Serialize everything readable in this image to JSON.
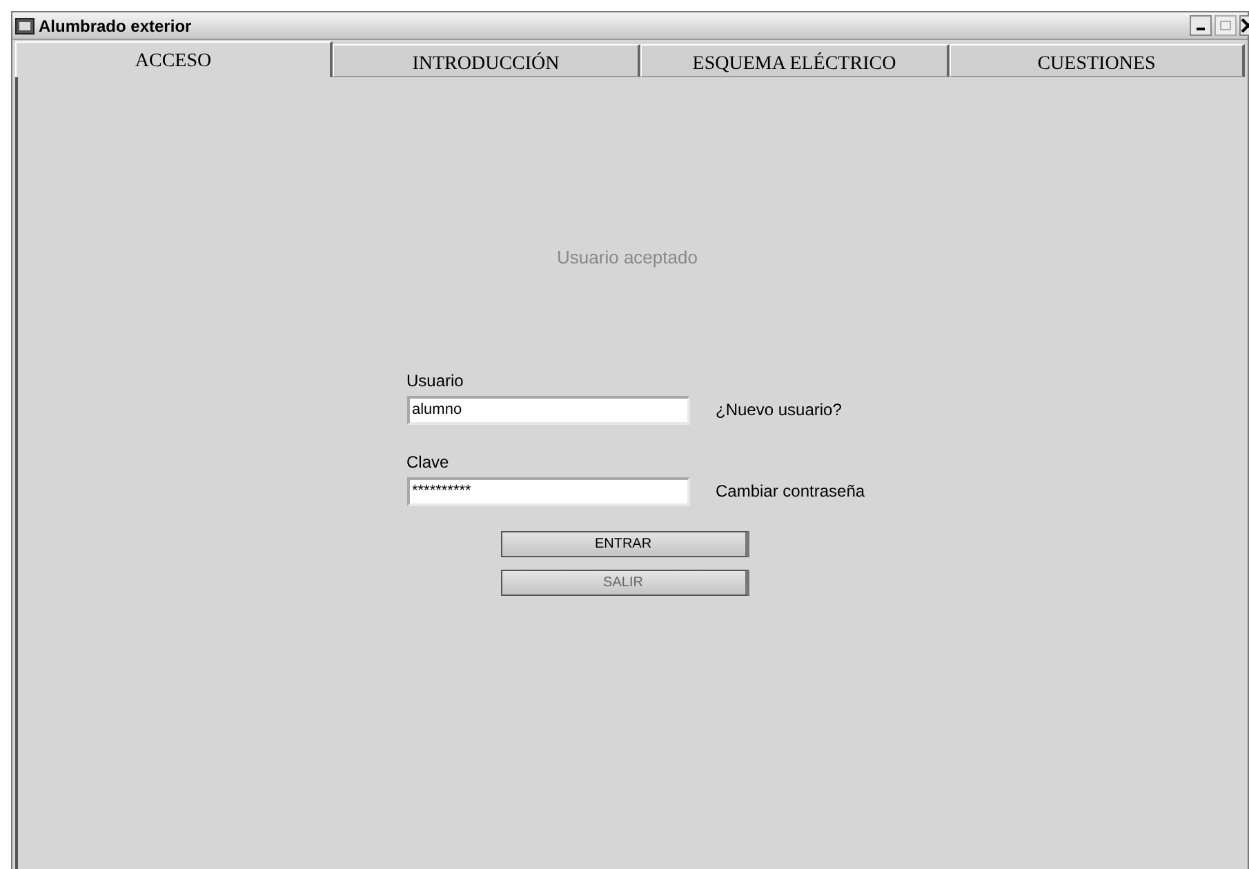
{
  "window": {
    "title": "Alumbrado exterior"
  },
  "tabs": [
    {
      "label": "ACCESO",
      "selected": true
    },
    {
      "label": "INTRODUCCIÓN",
      "selected": false
    },
    {
      "label": "ESQUEMA ELÉCTRICO",
      "selected": false
    },
    {
      "label": "CUESTIONES",
      "selected": false
    }
  ],
  "status_message": "Usuario aceptado",
  "fields": [
    {
      "label": "Usuario",
      "value": "alumno",
      "link": "¿Nuevo usuario?"
    },
    {
      "label": "Clave",
      "value": "**********",
      "link": "Cambiar contraseña"
    }
  ],
  "buttons": [
    {
      "label": "ENTRAR",
      "disabled": false
    },
    {
      "label": "SALIR",
      "disabled": true
    }
  ]
}
